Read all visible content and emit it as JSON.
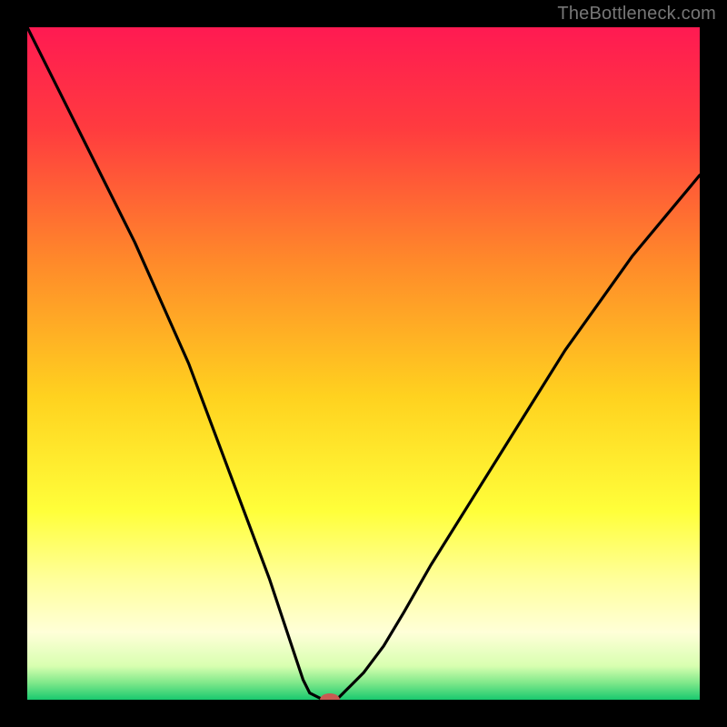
{
  "watermark": "TheBottleneck.com",
  "chart_data": {
    "type": "line",
    "title": "",
    "xlabel": "",
    "ylabel": "",
    "xlim": [
      0,
      100
    ],
    "ylim": [
      0,
      100
    ],
    "background_gradient": {
      "stops": [
        {
          "offset": 0.0,
          "color": "#ff1a52"
        },
        {
          "offset": 0.15,
          "color": "#ff3b3f"
        },
        {
          "offset": 0.35,
          "color": "#ff8a2a"
        },
        {
          "offset": 0.55,
          "color": "#ffd21f"
        },
        {
          "offset": 0.72,
          "color": "#ffff3a"
        },
        {
          "offset": 0.82,
          "color": "#ffff9a"
        },
        {
          "offset": 0.9,
          "color": "#ffffd8"
        },
        {
          "offset": 0.95,
          "color": "#d8ffb0"
        },
        {
          "offset": 0.975,
          "color": "#7fe88a"
        },
        {
          "offset": 1.0,
          "color": "#19c96f"
        }
      ]
    },
    "series": [
      {
        "name": "bottleneck-curve",
        "points": [
          {
            "x": 0,
            "y": 100
          },
          {
            "x": 4,
            "y": 92
          },
          {
            "x": 8,
            "y": 84
          },
          {
            "x": 12,
            "y": 76
          },
          {
            "x": 16,
            "y": 68
          },
          {
            "x": 20,
            "y": 59
          },
          {
            "x": 24,
            "y": 50
          },
          {
            "x": 27,
            "y": 42
          },
          {
            "x": 30,
            "y": 34
          },
          {
            "x": 33,
            "y": 26
          },
          {
            "x": 36,
            "y": 18
          },
          {
            "x": 38,
            "y": 12
          },
          {
            "x": 40,
            "y": 6
          },
          {
            "x": 41,
            "y": 3
          },
          {
            "x": 42,
            "y": 1
          },
          {
            "x": 44,
            "y": 0
          },
          {
            "x": 46,
            "y": 0
          },
          {
            "x": 48,
            "y": 2
          },
          {
            "x": 50,
            "y": 4
          },
          {
            "x": 53,
            "y": 8
          },
          {
            "x": 56,
            "y": 13
          },
          {
            "x": 60,
            "y": 20
          },
          {
            "x": 65,
            "y": 28
          },
          {
            "x": 70,
            "y": 36
          },
          {
            "x": 75,
            "y": 44
          },
          {
            "x": 80,
            "y": 52
          },
          {
            "x": 85,
            "y": 59
          },
          {
            "x": 90,
            "y": 66
          },
          {
            "x": 95,
            "y": 72
          },
          {
            "x": 100,
            "y": 78
          }
        ]
      }
    ],
    "marker": {
      "x": 45,
      "y": 0,
      "color": "#c95a52"
    }
  }
}
